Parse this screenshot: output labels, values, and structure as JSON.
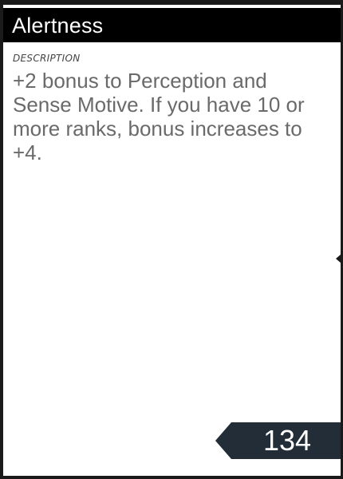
{
  "card": {
    "title": "Alertness",
    "description_label": "DESCRIPTION",
    "description": "+2 bonus to Perception and Sense Motive. If you have 10 or more ranks, bonus increases to +4.",
    "page_number": "134"
  },
  "colors": {
    "title_bar": "#000000",
    "title_text": "#ffffff",
    "description_text": "#6a6a6a",
    "page_badge": "#222d38"
  }
}
